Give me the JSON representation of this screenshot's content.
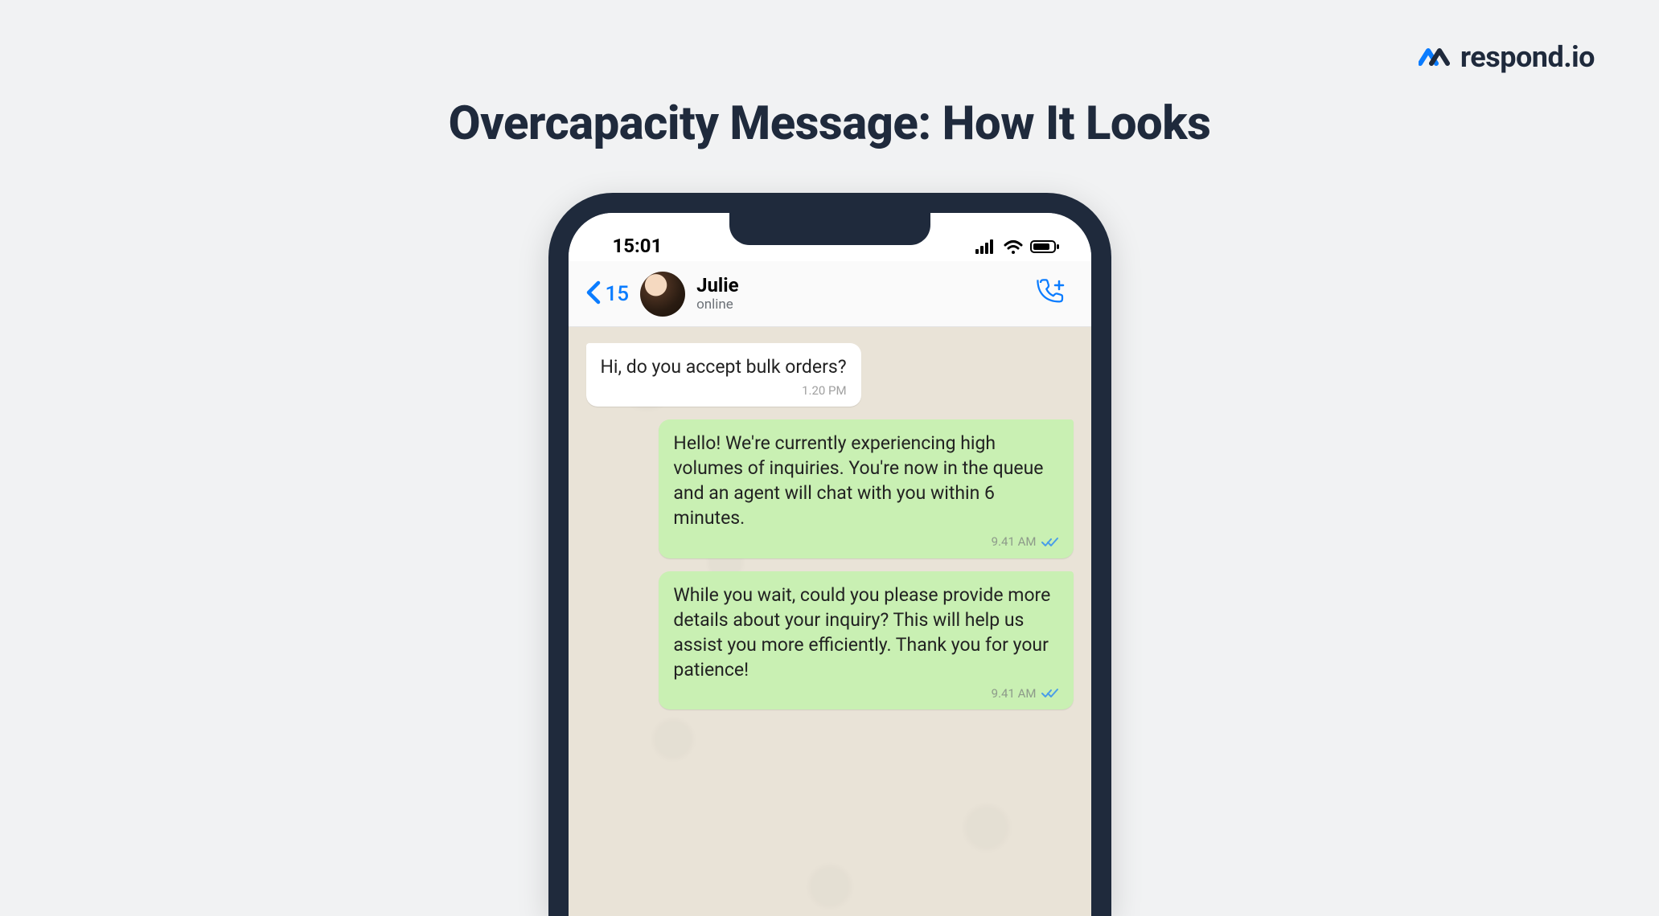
{
  "brand": {
    "name": "respond.io",
    "accent": "#0a7cff"
  },
  "page": {
    "title": "Overcapacity Message: How It Looks"
  },
  "phone": {
    "status": {
      "time": "15:01"
    },
    "chat_header": {
      "back_count": "15",
      "contact_name": "Julie",
      "contact_status": "online"
    },
    "messages": [
      {
        "direction": "in",
        "text": "Hi, do you accept bulk orders?",
        "time": "1.20 PM",
        "read": false
      },
      {
        "direction": "out",
        "text": "Hello! We're currently experiencing high volumes of inquiries. You're now in the queue and an agent will chat with you within 6 minutes.",
        "time": "9.41 AM",
        "read": true
      },
      {
        "direction": "out",
        "text": "While you wait, could you please provide more details about your inquiry? This will help us assist you more efficiently. Thank you for your patience!",
        "time": "9.41 AM",
        "read": true
      }
    ]
  }
}
